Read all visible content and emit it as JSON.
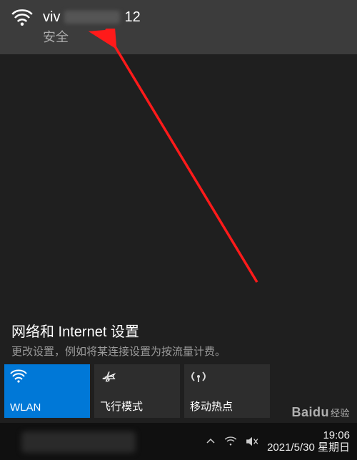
{
  "wifi": {
    "name_prefix": "viv",
    "name_suffix": "12",
    "status": "安全"
  },
  "settings": {
    "title": "网络和 Internet 设置",
    "subtitle": "更改设置，例如将某连接设置为按流量计费。"
  },
  "tiles": {
    "wlan": "WLAN",
    "airplane": "飞行模式",
    "hotspot": "移动热点"
  },
  "taskbar": {
    "time": "19:06",
    "date": "2021/5/30 星期日"
  },
  "watermark": {
    "brand": "Baidu",
    "suffix": "经验"
  }
}
